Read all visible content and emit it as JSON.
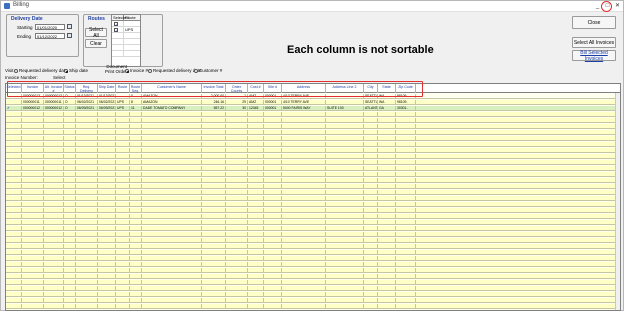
{
  "window": {
    "title": "Billing"
  },
  "delivery_date": {
    "title": "Delivery Date",
    "starting_label": "Starting",
    "starting_value": "01/01/2020",
    "ending_label": "Ending",
    "ending_value": "01/12/2022"
  },
  "routes": {
    "title": "Routes",
    "headers": [
      "Selected",
      "Route"
    ],
    "rows": [
      {
        "checked": true,
        "route": ""
      },
      {
        "checked": true,
        "route": "UPS"
      }
    ]
  },
  "buttons": {
    "select_all": "Select All",
    "clear": "Clear",
    "close": "Close",
    "select_all_invoices": "Select All Invoices",
    "bill_selected": "Bill Selected Invoices"
  },
  "note": "Each column is not sortable",
  "sort_options": {
    "visit_label": "Visit",
    "requested_delivery_date": "Requested delivery date",
    "ship_date": "Ship date",
    "document_label": "Document\nPrint Order:",
    "invoice_no": "Invoice #",
    "requested_delivery_date2": "Requested delivery date",
    "customer_no": "Customer #",
    "invoice_number_label": "Invoice Number:",
    "select_label": "Select"
  },
  "grid": {
    "columns": [
      "Selected",
      "Invoice",
      "Alt. Invoice #",
      "Status",
      "Req. Delivery Date",
      "Ship Date",
      "Route",
      "Route Seq.",
      "Customer's Name",
      "Invoice Total",
      "Order Counts",
      "Cust #",
      "Site #",
      "Address",
      "Address Line 2",
      "City",
      "State",
      "Zip Code"
    ],
    "rows": [
      [
        "",
        "000000013",
        "000000013",
        "O",
        "01/13/2021",
        "01/13/2021",
        "",
        "0",
        "AMAZON",
        "2,000.00",
        "1",
        "AMZ",
        "000001",
        "4/10 TERRY AVE",
        "",
        "SEATTLE",
        "WA",
        "98109-"
      ],
      [
        "",
        "000000011",
        "000000011",
        "O",
        "06/02/2021",
        "06/02/2021",
        "UPS",
        "8",
        "AMAZON",
        "246.16",
        "29",
        "AMZ",
        "000001",
        "4/10 TERRY AVE",
        "",
        "SEATTLE",
        "WA",
        "98109-"
      ],
      [
        "✔",
        "000000012",
        "000000012",
        "O",
        "06/09/2021",
        "06/09/2021",
        "UPS",
        "11",
        "DADE TOMATO COMPANY",
        "557.22",
        "30",
        "12345",
        "000001",
        "5000 FAIRIS WAY",
        "SUITE 100",
        "ATLANTA",
        "GA",
        "30301-"
      ]
    ]
  }
}
